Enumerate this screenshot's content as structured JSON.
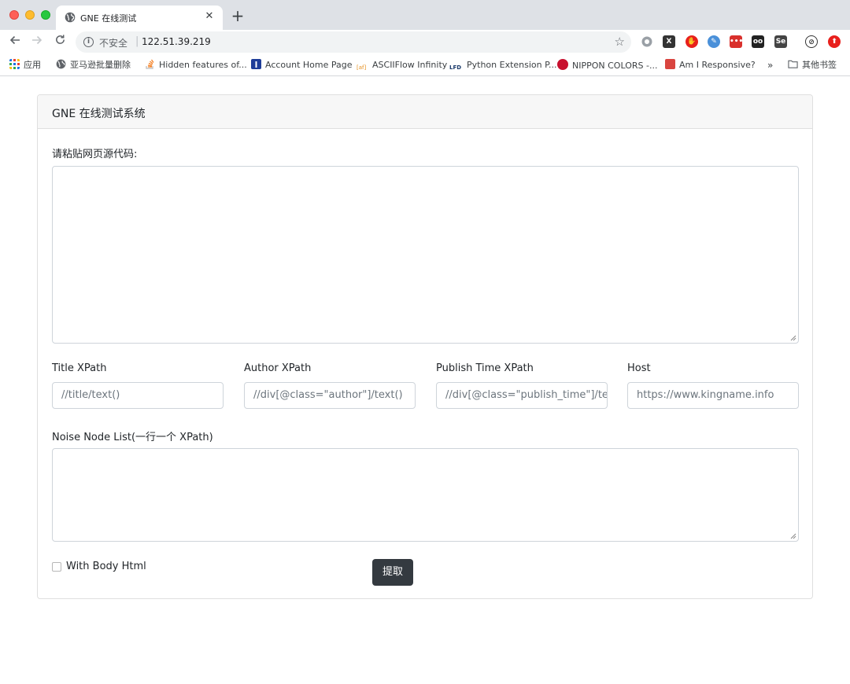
{
  "browser": {
    "tab_title": "GNE 在线测试",
    "tab_close": "✕",
    "new_tab": "+",
    "insecure_label": "不安全",
    "url_separator": "|",
    "url": "122.51.39.219",
    "bookmarks": [
      {
        "label": "应用",
        "icon": "apps-grid-icon"
      },
      {
        "label": "亚马逊批量删除",
        "icon": "globe-icon"
      },
      {
        "label": "Hidden features of...",
        "icon": "stackoverflow-icon"
      },
      {
        "label": "Account Home Page",
        "icon": "account-icon"
      },
      {
        "label": "ASCIIFlow Infinity",
        "icon": "asciiflow-icon"
      },
      {
        "label": "Python Extension P...",
        "icon": "lfd-icon"
      },
      {
        "label": "NIPPON COLORS -...",
        "icon": "nippon-icon"
      },
      {
        "label": "Am I Responsive?",
        "icon": "responsive-icon"
      },
      {
        "label": "其他书签",
        "icon": "folder-icon"
      }
    ],
    "bookmark_overflow": "»",
    "lfd_badge": "LFD",
    "asciiflow_badge": "[af]"
  },
  "page": {
    "card_title": "GNE 在线测试系统",
    "html_label": "请粘贴网页源代码:",
    "fields": [
      {
        "label": "Title XPath",
        "placeholder": "//title/text()"
      },
      {
        "label": "Author XPath",
        "placeholder": "//div[@class=\"author\"]/text()"
      },
      {
        "label": "Publish Time XPath",
        "placeholder": "//div[@class=\"publish_time\"]/text()"
      },
      {
        "label": "Host",
        "placeholder": "https://www.kingname.info"
      }
    ],
    "noise_label": "Noise Node List(一行一个 XPath)",
    "with_body_label": "With Body Html",
    "submit_label": "提取"
  },
  "colors": {
    "button_bg": "#343a40",
    "header_bg": "#f7f7f7",
    "border": "#ced4da"
  }
}
